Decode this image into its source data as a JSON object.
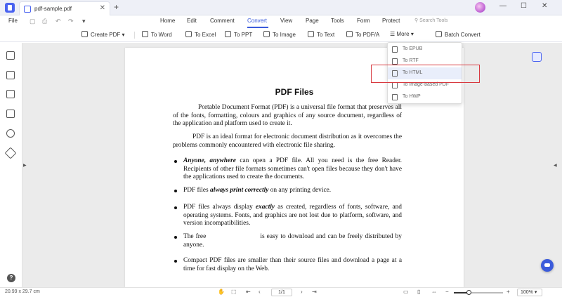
{
  "titlebar": {
    "tab_title": "pdf-sample.pdf",
    "close_glyph": "✕",
    "add_glyph": "+",
    "window_controls": [
      "—",
      "☐",
      "✕"
    ]
  },
  "menubar": {
    "file": "File",
    "items": [
      "Home",
      "Edit",
      "Comment",
      "Convert",
      "View",
      "Page",
      "Tools",
      "Form",
      "Protect"
    ],
    "active": "Convert",
    "search_placeholder": "Search Tools"
  },
  "toolbar": {
    "items": [
      "Create PDF",
      "To Word",
      "To Excel",
      "To PPT",
      "To Image",
      "To Text",
      "To PDF/A",
      "More",
      "Batch Convert"
    ]
  },
  "dropdown": {
    "items": [
      "To EPUB",
      "To RTF",
      "To HTML",
      "To Image-based PDF",
      "To HWP"
    ],
    "highlighted": "To HTML"
  },
  "document": {
    "title": "PDF Files",
    "p1": "Portable Document Format (PDF) is a universal file format that preserves all of the fonts, formatting, colours and graphics of any source document, regardless of the application and platform used to create it.",
    "p2": "PDF is an ideal format for electronic document distribution as it overcomes the problems commonly encountered with electronic file sharing.",
    "b1_em": "Anyone, anywhere",
    "b1_rest": " can open a PDF file. All you need is the free Reader. Recipients of other file formats sometimes can't open files because they don't have the applications used to create the documents.",
    "b2_a": "PDF files ",
    "b2_em": "always print correctly",
    "b2_b": " on any printing device.",
    "b3_a": "PDF files always display ",
    "b3_em": "exactly",
    "b3_b": " as created, regardless of fonts, software, and operating systems. Fonts, and graphics are not lost due to platform, software, and version incompatibilities.",
    "b4": "The free                         is easy to download and can be freely distributed by anyone.",
    "b5": "Compact PDF files are smaller than their source files and download a page at a time for fast display on the Web."
  },
  "statusbar": {
    "dimensions": "20.99 x 29.7 cm",
    "page_indicator": "1/1",
    "zoom": "100%",
    "zoom_level": 0.3
  }
}
